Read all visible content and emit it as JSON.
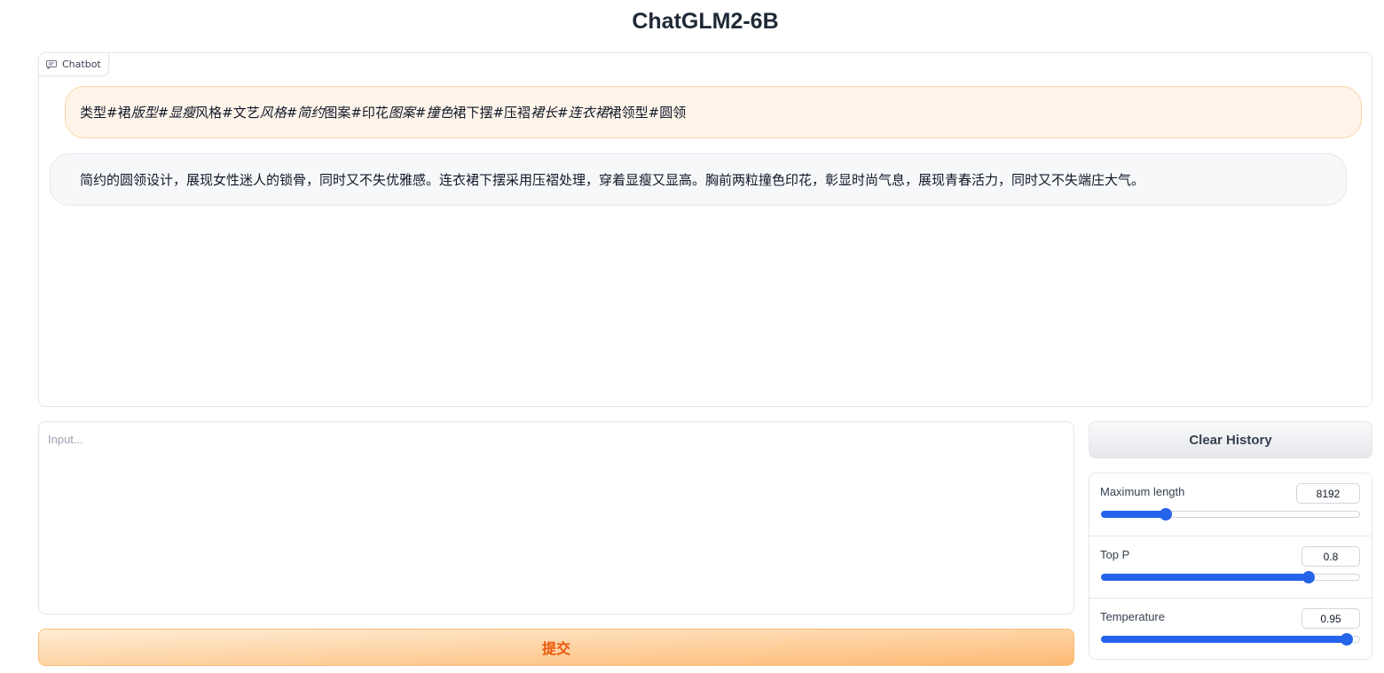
{
  "header": {
    "title": "ChatGLM2-6B"
  },
  "chatbot": {
    "label": "Chatbot",
    "user_message": [
      {
        "text": "类型#裙",
        "italic": false
      },
      {
        "text": "版型#显瘦",
        "italic": true
      },
      {
        "text": "风格#文艺",
        "italic": false
      },
      {
        "text": "风格#简约",
        "italic": true
      },
      {
        "text": "图案#印花",
        "italic": false
      },
      {
        "text": "图案#撞色",
        "italic": true
      },
      {
        "text": "裙下摆#压褶",
        "italic": false
      },
      {
        "text": "裙长#连衣裙",
        "italic": true
      },
      {
        "text": "裙领型#圆领",
        "italic": false
      }
    ],
    "bot_message": "简约的圆领设计，展现女性迷人的锁骨，同时又不失优雅感。连衣裙下摆采用压褶处理，穿着显瘦又显高。胸前两粒撞色印花，彰显时尚气息，展现青春活力，同时又不失端庄大气。"
  },
  "input": {
    "placeholder": "Input...",
    "value": ""
  },
  "buttons": {
    "submit_label": "提交",
    "clear_label": "Clear History"
  },
  "params": [
    {
      "label": "Maximum length",
      "value": "8192",
      "fraction": 0.25
    },
    {
      "label": "Top P",
      "value": "0.8",
      "fraction": 0.8
    },
    {
      "label": "Temperature",
      "value": "0.95",
      "fraction": 0.95
    }
  ],
  "colors": {
    "accent": "#2563eb",
    "submit_text": "#ea580c",
    "user_bubble": "#fff4ea"
  }
}
